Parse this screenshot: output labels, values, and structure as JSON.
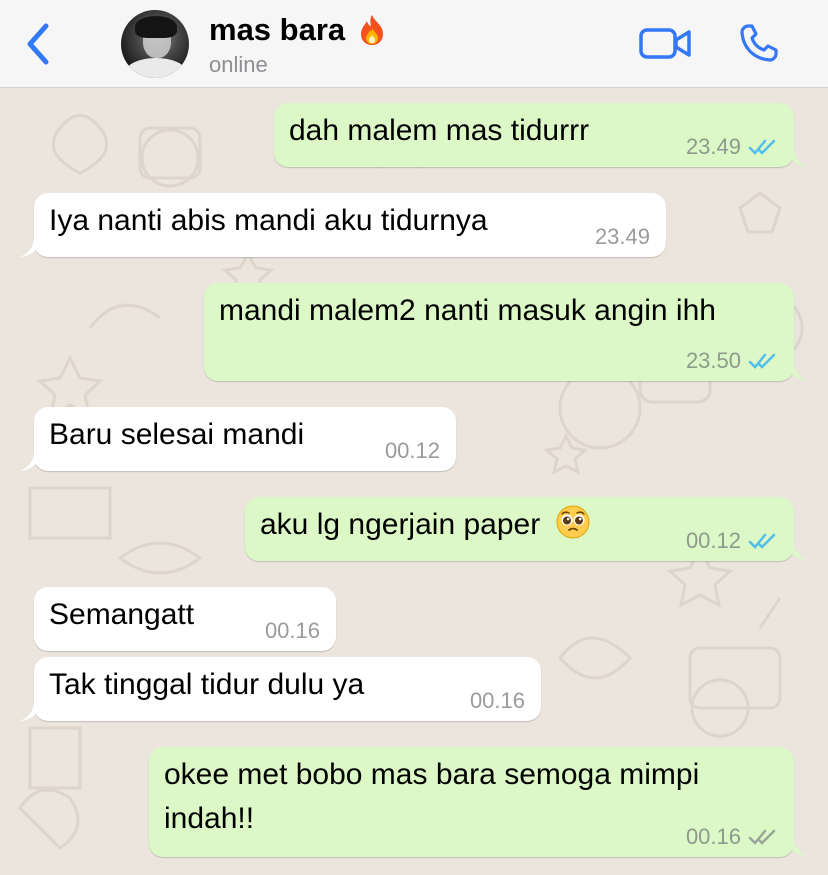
{
  "header": {
    "contact_name": "mas bara",
    "contact_status": "online"
  },
  "colors": {
    "accent": "#3478f6",
    "outgoing_bubble": "#dcf8c6",
    "incoming_bubble": "#ffffff",
    "chat_background": "#ece5dd",
    "read_ticks": "#53bdeb",
    "delivered_ticks": "#9aa59a"
  },
  "icons": {
    "back": "chevron-left-icon",
    "fire": "fire-emoji-icon",
    "video": "video-camera-icon",
    "phone": "phone-icon",
    "pleading_face": "pleading-face-emoji-icon"
  },
  "messages": [
    {
      "direction": "out",
      "text": "dah malem mas tidurrr",
      "time": "23.49",
      "ticks": "read"
    },
    {
      "direction": "in",
      "text": "Iya nanti abis mandi aku tidurnya",
      "time": "23.49"
    },
    {
      "direction": "out",
      "text": "mandi malem2 nanti masuk angin ihh",
      "time": "23.50",
      "ticks": "read"
    },
    {
      "direction": "in",
      "text": "Baru selesai mandi",
      "time": "00.12"
    },
    {
      "direction": "out",
      "text": "aku lg ngerjain paper",
      "time": "00.12",
      "ticks": "read",
      "emoji": "pleading-face"
    },
    {
      "direction": "in",
      "text": "Semangatt",
      "time": "00.16"
    },
    {
      "direction": "in",
      "text": "Tak tinggal tidur dulu ya",
      "time": "00.16"
    },
    {
      "direction": "out",
      "text": "okee met bobo mas bara semoga mimpi indah!!",
      "time": "00.16",
      "ticks": "delivered"
    }
  ]
}
